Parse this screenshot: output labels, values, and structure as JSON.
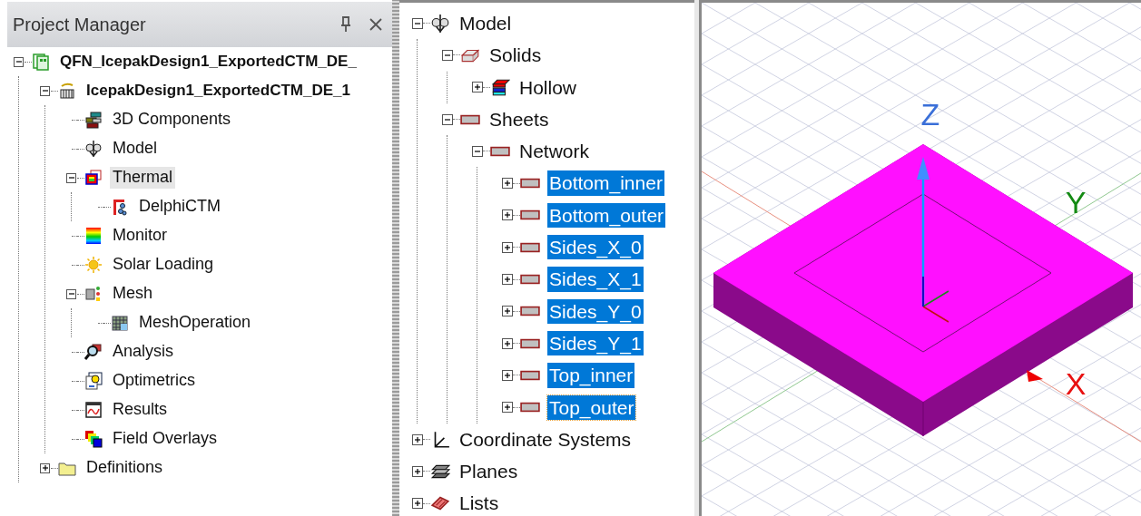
{
  "project_manager": {
    "title": "Project Manager",
    "tree": [
      {
        "label": "QFN_IcepakDesign1_ExportedCTM_DE_",
        "kind": "project",
        "bold": true,
        "expanded": true,
        "selected": false,
        "children": [
          {
            "label": "IcepakDesign1_ExportedCTM_DE_1",
            "kind": "design",
            "bold": true,
            "expanded": true,
            "selected": false,
            "children": [
              {
                "label": "3D Components",
                "kind": "components",
                "selected": false
              },
              {
                "label": "Model",
                "kind": "model",
                "selected": false
              },
              {
                "label": "Thermal",
                "kind": "thermal",
                "expanded": true,
                "selected": true,
                "children": [
                  {
                    "label": "DelphiCTM",
                    "kind": "network",
                    "selected": false
                  }
                ]
              },
              {
                "label": "Monitor",
                "kind": "monitor",
                "selected": false
              },
              {
                "label": "Solar Loading",
                "kind": "solar",
                "selected": false
              },
              {
                "label": "Mesh",
                "kind": "mesh",
                "expanded": true,
                "selected": false,
                "children": [
                  {
                    "label": "MeshOperation",
                    "kind": "meshop",
                    "selected": false
                  }
                ]
              },
              {
                "label": "Analysis",
                "kind": "analysis",
                "selected": false
              },
              {
                "label": "Optimetrics",
                "kind": "optimetrics",
                "selected": false
              },
              {
                "label": "Results",
                "kind": "results",
                "selected": false
              },
              {
                "label": "Field Overlays",
                "kind": "overlays",
                "selected": false
              }
            ]
          },
          {
            "label": "Definitions",
            "kind": "folder",
            "expanded": false,
            "selected": false
          }
        ]
      }
    ]
  },
  "model_tree": [
    {
      "label": "Model",
      "kind": "model",
      "expanded": true,
      "selected": false,
      "children": [
        {
          "label": "Solids",
          "kind": "solid",
          "expanded": true,
          "selected": false,
          "children": [
            {
              "label": "Hollow",
              "kind": "material",
              "expanded": false,
              "selected": false
            }
          ]
        },
        {
          "label": "Sheets",
          "kind": "sheet",
          "expanded": true,
          "selected": false,
          "children": [
            {
              "label": "Network",
              "kind": "sheet",
              "expanded": true,
              "selected": false,
              "children": [
                {
                  "label": "Bottom_inner",
                  "kind": "sheet",
                  "expanded": false,
                  "selected": true
                },
                {
                  "label": "Bottom_outer",
                  "kind": "sheet",
                  "expanded": false,
                  "selected": true
                },
                {
                  "label": "Sides_X_0",
                  "kind": "sheet",
                  "expanded": false,
                  "selected": true
                },
                {
                  "label": "Sides_X_1",
                  "kind": "sheet",
                  "expanded": false,
                  "selected": true
                },
                {
                  "label": "Sides_Y_0",
                  "kind": "sheet",
                  "expanded": false,
                  "selected": true
                },
                {
                  "label": "Sides_Y_1",
                  "kind": "sheet",
                  "expanded": false,
                  "selected": true
                },
                {
                  "label": "Top_inner",
                  "kind": "sheet",
                  "expanded": false,
                  "selected": true
                },
                {
                  "label": "Top_outer",
                  "kind": "sheet",
                  "expanded": false,
                  "selected": true,
                  "focused": true
                }
              ]
            }
          ]
        }
      ]
    },
    {
      "label": "Coordinate Systems",
      "kind": "coords",
      "expanded": false,
      "selected": false
    },
    {
      "label": "Planes",
      "kind": "planes",
      "expanded": false,
      "selected": false
    },
    {
      "label": "Lists",
      "kind": "lists",
      "expanded": false,
      "selected": false
    }
  ],
  "viewport": {
    "axes": [
      {
        "label": "Z",
        "kind": "z"
      },
      {
        "label": "Y",
        "kind": "y"
      },
      {
        "label": "X",
        "kind": "x"
      }
    ]
  }
}
